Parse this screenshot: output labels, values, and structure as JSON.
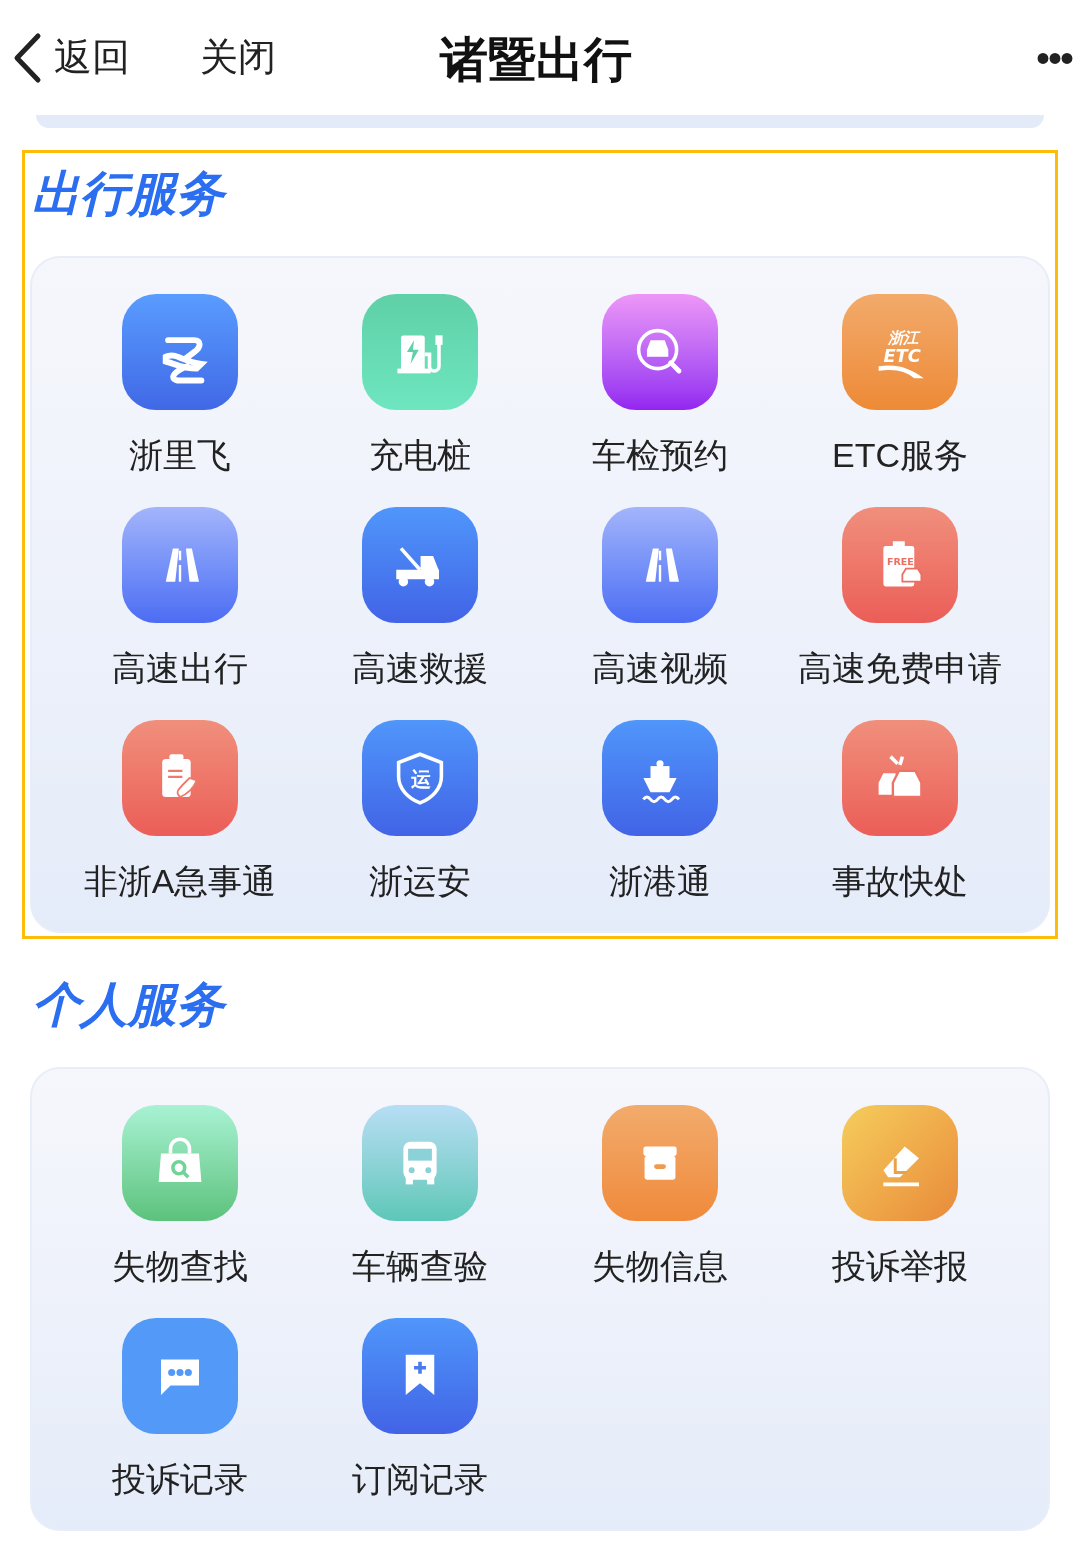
{
  "nav": {
    "back": "返回",
    "close": "关闭",
    "title": "诸暨出行",
    "more": "•••"
  },
  "sections": [
    {
      "title": "出行服务",
      "highlighted": true,
      "items": [
        {
          "label": "浙里飞",
          "kind": "flight"
        },
        {
          "label": "充电桩",
          "kind": "charger"
        },
        {
          "label": "车检预约",
          "kind": "inspect"
        },
        {
          "label": "ETC服务",
          "kind": "etc",
          "badge": [
            "浙江",
            "ETC"
          ]
        },
        {
          "label": "高速出行",
          "kind": "highway"
        },
        {
          "label": "高速救援",
          "kind": "tow"
        },
        {
          "label": "高速视频",
          "kind": "highway"
        },
        {
          "label": "高速免费申请",
          "kind": "free",
          "badge": [
            "FREE"
          ]
        },
        {
          "label": "非浙A急事通",
          "kind": "urgent"
        },
        {
          "label": "浙运安",
          "kind": "shield",
          "badge": [
            "运"
          ]
        },
        {
          "label": "浙港通",
          "kind": "ship"
        },
        {
          "label": "事故快处",
          "kind": "accident"
        }
      ]
    },
    {
      "title": "个人服务",
      "highlighted": false,
      "items": [
        {
          "label": "失物查找",
          "kind": "lostfind"
        },
        {
          "label": "车辆查验",
          "kind": "bus"
        },
        {
          "label": "失物信息",
          "kind": "box"
        },
        {
          "label": "投诉举报",
          "kind": "eraser"
        },
        {
          "label": "投诉记录",
          "kind": "chat"
        },
        {
          "label": "订阅记录",
          "kind": "bookmark"
        }
      ]
    }
  ]
}
